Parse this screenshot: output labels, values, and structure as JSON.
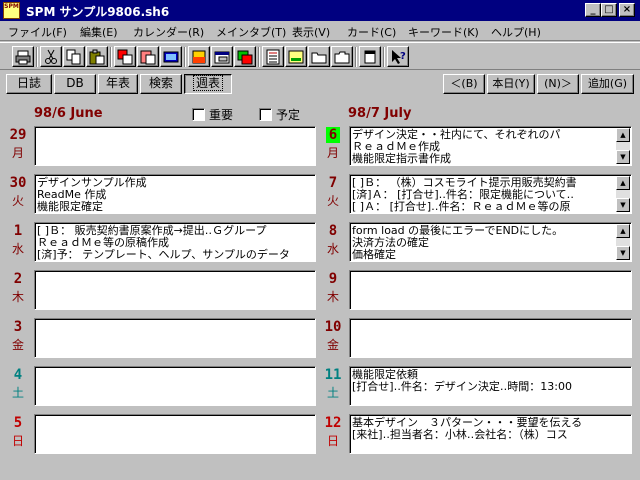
{
  "window": {
    "icon_text": "SPM",
    "title": "SPM サンプル9806.sh6",
    "buttons": {
      "minimize": "_",
      "maximize": "□",
      "close": "×"
    }
  },
  "menu": [
    "ファイル(F)",
    "編集(E)",
    "カレンダー(R)",
    "メインタブ(T)",
    "表示(V)",
    "カード(C)",
    "キーワード(K)",
    "ヘルプ(H)"
  ],
  "toolbar": {
    "icons": [
      "print-icon",
      "cut-icon",
      "copy-icon",
      "paste-icon",
      "copy-card-icon",
      "clipboard-card-icon",
      "card-view-icon",
      "color-icon",
      "window-icon",
      "color-window-icon",
      "folder-icon",
      "open-folder-icon",
      "list-icon",
      "note-icon",
      "doc-icon",
      "page-icon",
      "help-icon"
    ]
  },
  "tabs": [
    "日誌",
    "DB",
    "年表",
    "検索",
    "週表"
  ],
  "active_tab": "週表",
  "nav": {
    "prev": "＜(B)",
    "today": "本日(Y)",
    "next": "(N)＞",
    "add": "追加(G)"
  },
  "left_header": {
    "month": "98/6 June",
    "flag1": "重要",
    "flag2": "予定"
  },
  "right_header": {
    "month": "98/7 July"
  },
  "left_days": [
    {
      "num": "29",
      "wk": "月",
      "color": "maroon",
      "entries": []
    },
    {
      "num": "30",
      "wk": "火",
      "color": "maroon",
      "entries": [
        "    デザインサンプル作成",
        "     ReadMe 作成",
        "     機能限定確定"
      ]
    },
    {
      "num": "1",
      "wk": "水",
      "color": "maroon",
      "entries": [
        "[  ]Ｂ： 販売契約書原案作成→提出‥Ｇグループ",
        "    ＲｅａｄＭｅ等の原稿作成",
        "[済]予： テンプレート、ヘルプ、サンプルのデータ"
      ]
    },
    {
      "num": "2",
      "wk": "木",
      "color": "maroon",
      "entries": []
    },
    {
      "num": "3",
      "wk": "金",
      "color": "maroon",
      "entries": []
    },
    {
      "num": "4",
      "wk": "土",
      "color": "teal",
      "entries": []
    },
    {
      "num": "5",
      "wk": "日",
      "color": "red",
      "entries": []
    }
  ],
  "right_days": [
    {
      "num": "6",
      "wk": "月",
      "color": "maroon",
      "today": true,
      "entries": [
        "     デザイン決定・・社内にて、それぞれのパ",
        "     ＲｅａｄＭｅ作成",
        "     機能限定指示書作成"
      ]
    },
    {
      "num": "7",
      "wk": "火",
      "color": "maroon",
      "entries": [
        "[  ]Ｂ： （株）コスモライト提示用販売契約書",
        "[済]Ａ： [打合せ]‥件名：限定機能について‥",
        "[  ]Ａ： [打合せ]‥件名：ＲｅａｄＭｅ等の原"
      ]
    },
    {
      "num": "8",
      "wk": "水",
      "color": "maroon",
      "entries": [
        "     form load の最後にエラーでENDにした。",
        "     決済方法の確定",
        "     価格確定"
      ]
    },
    {
      "num": "9",
      "wk": "木",
      "color": "maroon",
      "entries": []
    },
    {
      "num": "10",
      "wk": "金",
      "color": "maroon",
      "entries": []
    },
    {
      "num": "11",
      "wk": "土",
      "color": "teal",
      "entries": [
        "     機能限定依頼",
        "     [打合せ]‥件名：デザイン決定‥時間：13:00"
      ]
    },
    {
      "num": "12",
      "wk": "日",
      "color": "red",
      "entries": [
        "     基本デザイン　３パターン・・・要望を伝える",
        "     [来社]‥担当者名：小林‥会社名：（株）コス"
      ]
    }
  ]
}
